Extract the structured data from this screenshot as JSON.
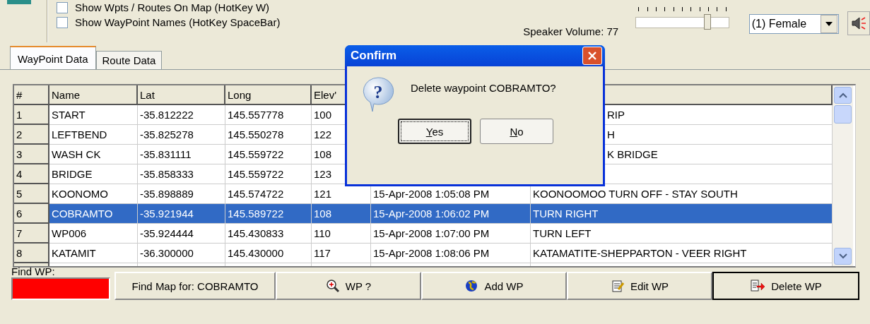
{
  "options": {
    "checkboxes": [
      {
        "label": "Show Wpts / Routes On Map (HotKey W)",
        "checked": false
      },
      {
        "label": "Show WayPoint Names (HotKey SpaceBar)",
        "checked": false
      }
    ]
  },
  "speaker": {
    "label": "Speaker Volume: 77",
    "level": 0.77
  },
  "voice": {
    "value": "(1) Female"
  },
  "tabs": [
    {
      "label": "WayPoint Data",
      "selected": true
    },
    {
      "label": "Route Data",
      "selected": false
    }
  ],
  "table": {
    "columns": [
      "#",
      "Name",
      "Lat",
      "Long",
      "Elev'"
    ],
    "rows": [
      {
        "num": "1",
        "name": "START",
        "lat": "-35.812222",
        "long": "145.557778",
        "elev": "100",
        "notes": "RIP",
        "partly_covered": true,
        "selected": false
      },
      {
        "num": "2",
        "name": "LEFTBEND",
        "lat": "-35.825278",
        "long": "145.550278",
        "elev": "122",
        "notes": "H",
        "partly_covered": true,
        "selected": false
      },
      {
        "num": "3",
        "name": "WASH CK",
        "lat": "-35.831111",
        "long": "145.559722",
        "elev": "108",
        "notes": "K BRIDGE",
        "partly_covered": true,
        "selected": false
      },
      {
        "num": "4",
        "name": "BRIDGE",
        "lat": "-35.858333",
        "long": "145.559722",
        "elev": "123",
        "selected": false
      },
      {
        "num": "5",
        "name": "KOONOMO",
        "lat": "-35.898889",
        "long": "145.574722",
        "elev": "121",
        "date": "15-Apr-2008 1:05:08 PM",
        "notes": "KOONOOMOO TURN OFF - STAY SOUTH",
        "partly_covered": false,
        "selected": false
      },
      {
        "num": "6",
        "name": "COBRAMTO",
        "lat": "-35.921944",
        "long": "145.589722",
        "elev": "108",
        "date": "15-Apr-2008 1:06:02 PM",
        "notes": "TURN RIGHT",
        "partly_covered": false,
        "selected": true
      },
      {
        "num": "7",
        "name": "WP006",
        "lat": "-35.924444",
        "long": "145.430833",
        "elev": "110",
        "date": "15-Apr-2008 1:07:00 PM",
        "notes": "TURN LEFT",
        "partly_covered": false,
        "selected": false
      },
      {
        "num": "8",
        "name": "KATAMIT",
        "lat": "-36.300000",
        "long": "145.430000",
        "elev": "117",
        "date": "15-Apr-2008 1:08:06 PM",
        "notes": "KATAMATITE-SHEPPARTON - VEER RIGHT",
        "partly_covered": false,
        "selected": false
      }
    ]
  },
  "find": {
    "label": "Find WP:"
  },
  "buttons": [
    {
      "label": "Find Map for: COBRAMTO",
      "kind": "plain",
      "focused": false
    },
    {
      "label": "WP ?",
      "kind": "magnifier",
      "focused": false
    },
    {
      "label": "Add WP",
      "kind": "globe",
      "focused": false
    },
    {
      "label": "Edit WP",
      "kind": "edit",
      "focused": false
    },
    {
      "label": "Delete WP",
      "kind": "delete",
      "focused": true
    }
  ],
  "dialog": {
    "title": "Confirm",
    "icon_glyph": "?",
    "message": "Delete waypoint COBRAMTO?",
    "buttons": [
      {
        "label": "Yes",
        "focused": true
      },
      {
        "label": "No",
        "focused": false
      }
    ]
  }
}
